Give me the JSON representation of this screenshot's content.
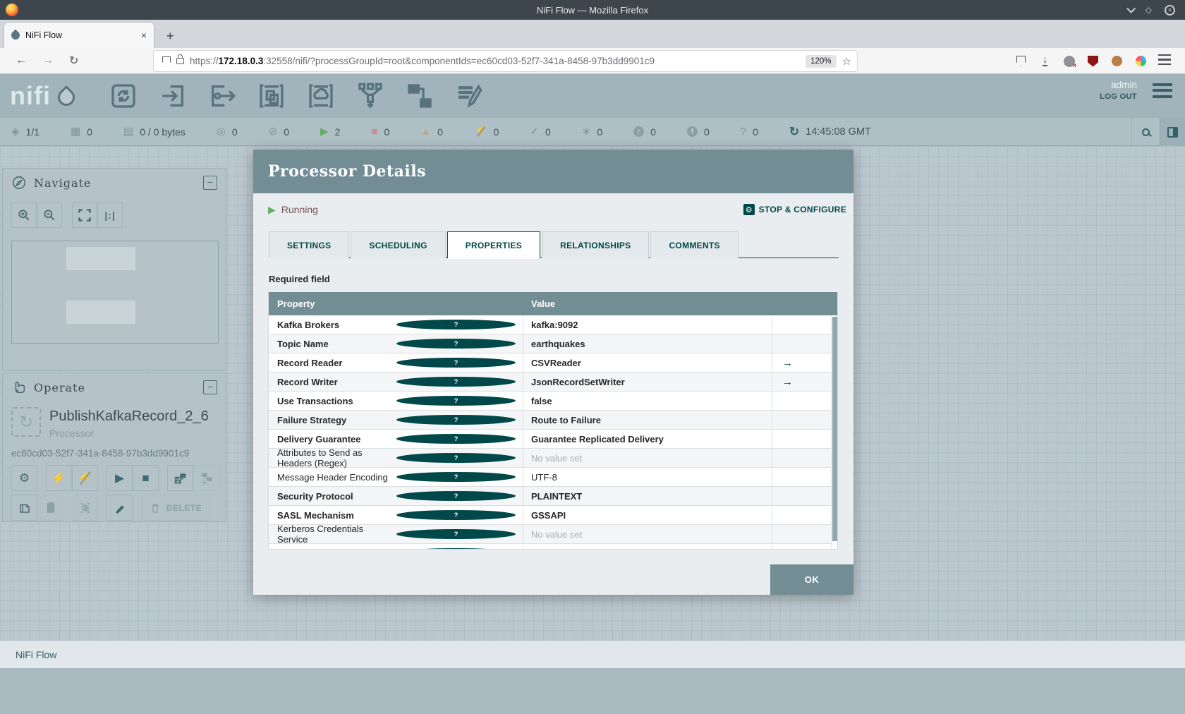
{
  "browser": {
    "window_title": "NiFi Flow — Mozilla Firefox",
    "tab_title": "NiFi Flow",
    "tab_close": "×",
    "new_tab": "+",
    "url_scheme": "https://",
    "url_host": "172.18.0.3",
    "url_path": ":32558/nifi/?processGroupId=root&componentIds=ec60cd03-52f7-341a-8458-97b3dd9901c9",
    "zoom_badge": "120%"
  },
  "header": {
    "logo_text": "nifi",
    "user_name": "admin",
    "logout_label": "LOG OUT"
  },
  "statusbar": {
    "connected_nodes": "1/1",
    "active_threads": "0",
    "queued": "0 / 0 bytes",
    "transmitting": "0",
    "not_transmitting": "0",
    "running": "2",
    "stopped": "0",
    "invalid": "0",
    "disabled": "0",
    "up_to_date": "0",
    "locally_modified": "0",
    "stale": "0",
    "locally_modified_stale": "0",
    "sync_failure": "0",
    "last_refresh": "14:45:08 GMT"
  },
  "navigate": {
    "title": "Navigate"
  },
  "operate": {
    "title": "Operate",
    "component_name": "PublishKafkaRecord_2_6",
    "component_type": "Processor",
    "component_id": "ec60cd03-52f7-341a-8458-97b3dd9901c9",
    "delete_label": "DELETE"
  },
  "dialog": {
    "title": "Processor Details",
    "status_label": "Running",
    "stop_configure_label": "STOP & CONFIGURE",
    "tabs": [
      "SETTINGS",
      "SCHEDULING",
      "PROPERTIES",
      "RELATIONSHIPS",
      "COMMENTS"
    ],
    "active_tab": "PROPERTIES",
    "required_note": "Required field",
    "columns": {
      "property": "Property",
      "value": "Value"
    },
    "rows": [
      {
        "property": "Kafka Brokers",
        "value": "kafka:9092",
        "required": true
      },
      {
        "property": "Topic Name",
        "value": "earthquakes",
        "required": true
      },
      {
        "property": "Record Reader",
        "value": "CSVReader",
        "required": true,
        "link": true
      },
      {
        "property": "Record Writer",
        "value": "JsonRecordSetWriter",
        "required": true,
        "link": true
      },
      {
        "property": "Use Transactions",
        "value": "false",
        "required": true
      },
      {
        "property": "Failure Strategy",
        "value": "Route to Failure",
        "required": true
      },
      {
        "property": "Delivery Guarantee",
        "value": "Guarantee Replicated Delivery",
        "required": true
      },
      {
        "property": "Attributes to Send as Headers (Regex)",
        "value": "No value set",
        "required": false,
        "unset": true
      },
      {
        "property": "Message Header Encoding",
        "value": "UTF-8",
        "required": false
      },
      {
        "property": "Security Protocol",
        "value": "PLAINTEXT",
        "required": true
      },
      {
        "property": "SASL Mechanism",
        "value": "GSSAPI",
        "required": true
      },
      {
        "property": "Kerberos Credentials Service",
        "value": "No value set",
        "required": false,
        "unset": true
      }
    ],
    "ok_label": "OK"
  },
  "breadcrumb": "NiFi Flow",
  "colors": {
    "accent_teal": "#004849",
    "gray_teal": "#728e94",
    "running_green": "#63b163",
    "status_value": "#775351"
  },
  "icons": {
    "cluster": "◈",
    "threads_grid": "▦",
    "queued_list": "▤",
    "bullseye": "◎",
    "slash_circle": "⊘",
    "play": "▶",
    "stop": "■",
    "warning_triangle": "▲",
    "bolt": "⚡",
    "check": "✓",
    "asterisk": "∗",
    "arrow_up": "↑",
    "exclamation": "!",
    "question": "?",
    "refresh": "↻",
    "go_to_arrow": "→",
    "help": "?",
    "collapse_minus": "−",
    "back": "←",
    "forward": "→",
    "reload": "↻",
    "star": "☆",
    "diamond": "◇",
    "gear": "⚙",
    "one_to_one": "|:|",
    "processor_refresh": "↻"
  }
}
